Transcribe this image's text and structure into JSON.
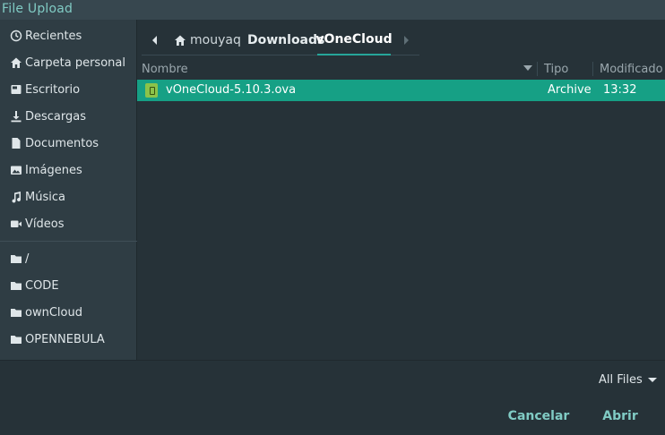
{
  "window": {
    "title": "File Upload"
  },
  "sidebar": {
    "places": [
      {
        "label": "Recientes",
        "icon": "clock-icon"
      },
      {
        "label": "Carpeta personal",
        "icon": "home-icon"
      },
      {
        "label": "Escritorio",
        "icon": "desktop-icon"
      },
      {
        "label": "Descargas",
        "icon": "download-icon"
      },
      {
        "label": "Documentos",
        "icon": "document-icon"
      },
      {
        "label": "Imágenes",
        "icon": "image-icon"
      },
      {
        "label": "Música",
        "icon": "music-icon"
      },
      {
        "label": "Vídeos",
        "icon": "video-icon"
      }
    ],
    "bookmarks": [
      {
        "label": "/",
        "icon": "folder-icon"
      },
      {
        "label": "CODE",
        "icon": "folder-icon"
      },
      {
        "label": "ownCloud",
        "icon": "folder-icon"
      },
      {
        "label": "OPENNEBULA",
        "icon": "folder-icon"
      }
    ]
  },
  "pathbar": {
    "home": "mouyaq",
    "segments": [
      "Downloads",
      "vOneCloud"
    ]
  },
  "columns": {
    "name": "Nombre",
    "type": "Tipo",
    "modified": "Modificado"
  },
  "files": [
    {
      "name": "vOneCloud-5.10.3.ova",
      "type": "Archive",
      "modified": "13:32",
      "selected": true
    }
  ],
  "filter": {
    "selected": "All Files"
  },
  "buttons": {
    "cancel": "Cancelar",
    "open": "Abrir"
  },
  "colors": {
    "accent": "#16a085",
    "accent_text": "#80cbc4",
    "background": "#263238",
    "sidebar": "#2f3d44"
  }
}
